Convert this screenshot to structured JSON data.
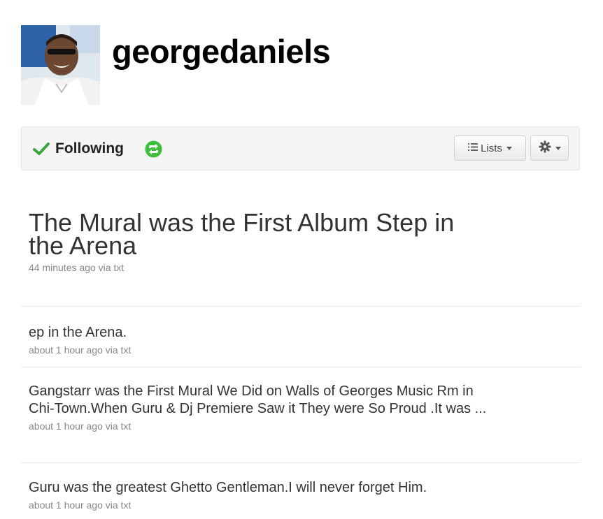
{
  "profile": {
    "username": "georgedaniels"
  },
  "actions": {
    "following_label": "Following",
    "lists_label": "Lists"
  },
  "tweets": [
    {
      "text": "The Mural was the First Album Step in the Arena",
      "meta": "44 minutes ago via txt"
    },
    {
      "text": "ep in the Arena.",
      "meta": "about 1 hour ago via txt"
    },
    {
      "text": "Gangstarr was the First Mural We Did on Walls of Georges Music Rm in Chi-Town.When Guru & Dj Premiere Saw it They were So Proud .It was ...",
      "meta": "about 1 hour ago via txt"
    },
    {
      "text": "Guru was the greatest Ghetto Gentleman.I will never forget Him.",
      "meta": "about 1 hour ago via txt"
    }
  ],
  "icons": {
    "check": "check-icon",
    "retweet": "retweet-icon",
    "list": "list-icon",
    "gear": "gear-icon"
  },
  "colors": {
    "check_green": "#3aa53a",
    "retweet_green": "#3dbf3d",
    "tweet_text": "#333333",
    "meta_text": "#888888"
  }
}
